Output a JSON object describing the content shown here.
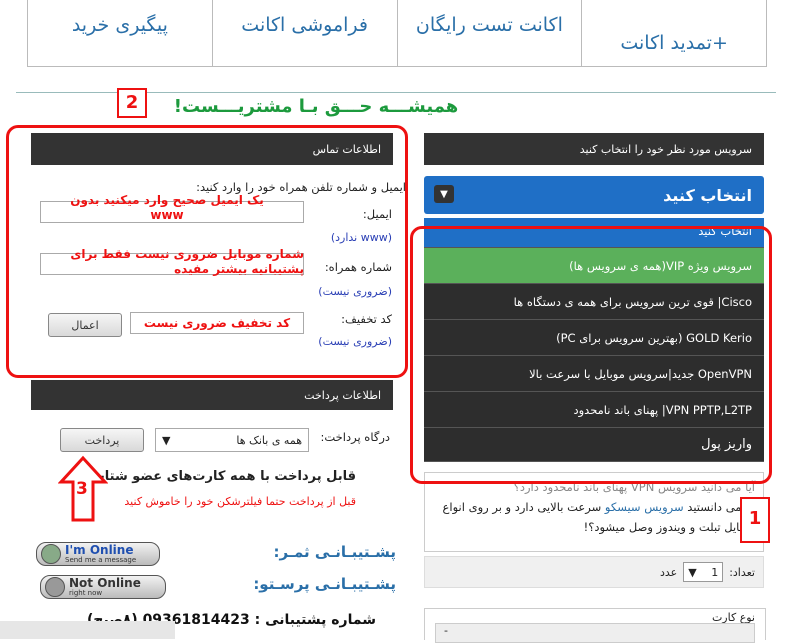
{
  "nav": {
    "tabs": [
      "+تمدید اکانت",
      "اکانت تست رایگان",
      "فراموشی اکانت",
      "پیگیری خرید"
    ]
  },
  "slogan": "همیشـــه حـــق بـا مشتریـــست!",
  "annotations": {
    "n1": "1",
    "n2": "2",
    "n3": "3",
    "email_note": "یک ایمیل صحیح وارد میکنید بدون www",
    "mobile_note": "شماره موبایل ضروری نیست فقط برای پشتیبانیه بیشتر مفیده",
    "discount_note": "کد تخفیف ضروری نیست"
  },
  "service": {
    "header": "سرویس مورد نظر خود را انتخاب کنید",
    "select_label": "انتخاب کنید",
    "options": [
      "انتخاب کنید",
      "سرویس ویژه VIP(همه ی سرویس ها)",
      "Cisco| قوی ترین سرویس برای همه ی دستگاه ها",
      "GOLD Kerio (بهترین سرویس برای PC)",
      "OpenVPN جدید|سرویس موبایل با سرعت بالا",
      "VPN PPTP,L2TP| پهنای باند نامحدود",
      "واریز پول"
    ],
    "selected_index": 1,
    "desc_line1": "آیا می دانید سرویس VPN پهنای باند نامحدود دارد؟",
    "desc_line2_pre": "آیا می دانستید ",
    "desc_line2_link": "سرویس سیسکو",
    "desc_line2_post": " سرعت بالایی دارد و بر روی انواع",
    "desc_line3": "موبایل تبلت و ویندوز وصل میشود؟!",
    "qty_label": "تعداد:",
    "qty_value": "1",
    "qty_unit": "عدد",
    "card_type_label": "نوع کارت",
    "card_type_value": "-"
  },
  "contact": {
    "header": "اطلاعات تماس",
    "intro": "ایمیل و شماره تلفن همراه خود را وارد کنید:",
    "email_label": "ایمیل:",
    "email_hint": "(www ندارد)",
    "mobile_label": "شماره همراه:",
    "mobile_hint": "(ضروری نیست)",
    "discount_label": "کد تخفیف:",
    "discount_hint": "(ضروری نیست)",
    "apply_button": "اعمال"
  },
  "payment": {
    "header": "اطلاعات پرداخت",
    "gateway_label": "درگاه پرداخت:",
    "gateway_value": "همه ی بانک ها",
    "pay_button": "پرداخت",
    "cards_note": "قابل پرداخت با همه کارت‌های عضو شتاب",
    "warning": "قبل از پرداخت حتما فیلترشکن خود را خاموش کنید"
  },
  "support": {
    "line1": "پشـتیبـانـی ثمـر:",
    "line2": "پشـتیبـانـی پرسـتو:",
    "online_title": "I'm Online",
    "online_sub": "Send me a message",
    "offline_title": "Not Online",
    "offline_sub": "right now",
    "phone": "شماره پشتیبانی : 09361814423 (۸صبح)"
  }
}
